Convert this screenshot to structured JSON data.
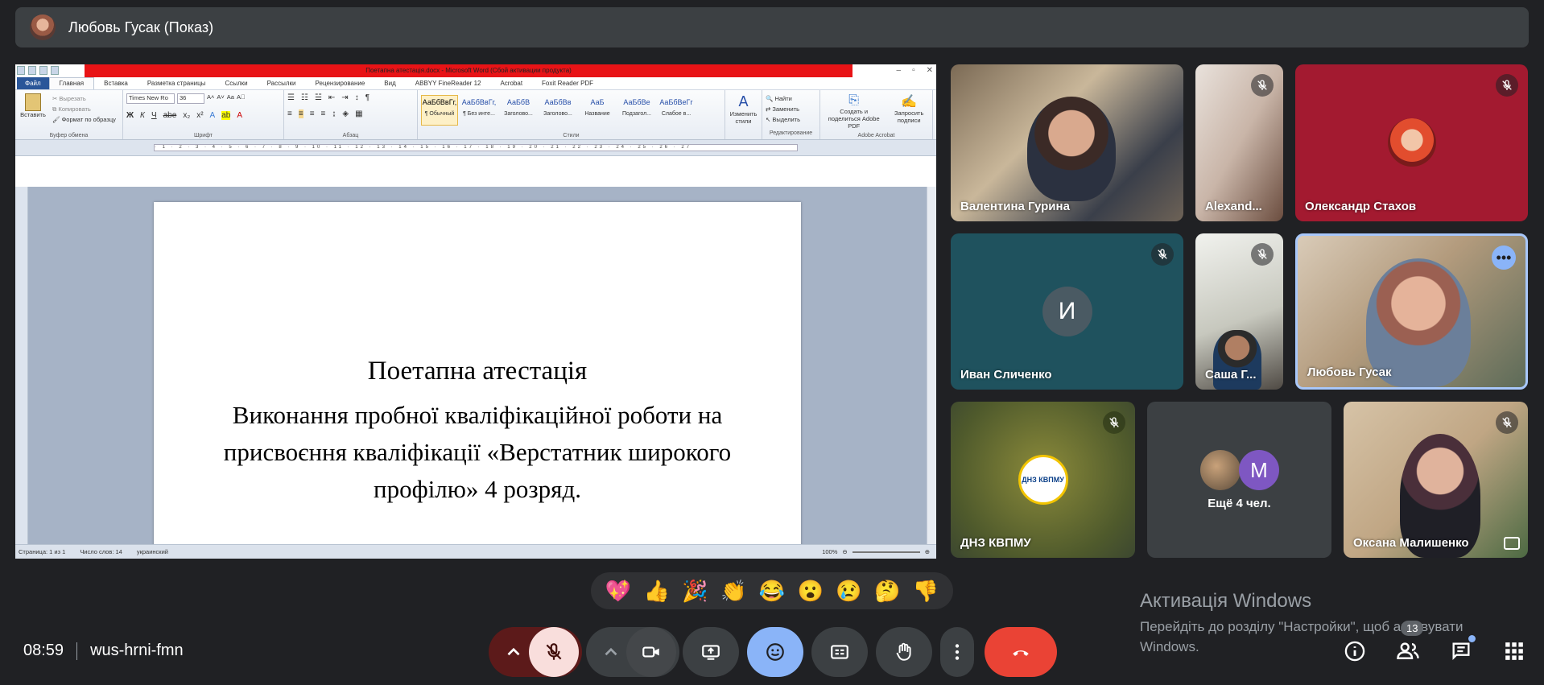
{
  "presenter": {
    "label": "Любовь Гусак (Показ)"
  },
  "word": {
    "title": "Поетапна атестація.docx - Microsoft Word (Сбой активации продукта)",
    "tabs": [
      "Файл",
      "Главная",
      "Вставка",
      "Разметка страницы",
      "Ссылки",
      "Рассылки",
      "Рецензирование",
      "Вид",
      "ABBYY FineReader 12",
      "Acrobat",
      "Foxit Reader PDF"
    ],
    "clipboard": {
      "paste": "Вставить",
      "cut": "Вырезать",
      "copy": "Копировать",
      "format": "Формат по образцу",
      "group": "Буфер обмена"
    },
    "font": {
      "name": "Times New Ro",
      "size": "36",
      "group": "Шрифт"
    },
    "paragraph_group": "Абзац",
    "styles": [
      {
        "sample": "АаБбВвГг,",
        "name": "¶ Обычный"
      },
      {
        "sample": "АаБбВвГг,",
        "name": "¶ Без инте..."
      },
      {
        "sample": "АаБбВ",
        "name": "Заголово..."
      },
      {
        "sample": "АаБбВв",
        "name": "Заголово..."
      },
      {
        "sample": "АаБ",
        "name": "Название"
      },
      {
        "sample": "АаБбВе",
        "name": "Подзагол..."
      },
      {
        "sample": "АаБбВеГг",
        "name": "Слабое в..."
      }
    ],
    "styles_group": "Стили",
    "change_styles": "Изменить стили",
    "editing": {
      "find": "Найти",
      "replace": "Заменить",
      "select": "Выделить",
      "group": "Редактирование"
    },
    "acrobat": {
      "create": "Создать и поделиться Adobe PDF",
      "request": "Запросить подписи",
      "group": "Adobe Acrobat"
    },
    "doc": {
      "heading": "Поетапна атестація",
      "body": "Виконання пробної кваліфікаційної роботи на присвоєння кваліфікації «Верстатник широкого профілю» 4 розряд."
    },
    "status": {
      "page": "Страница: 1 из 1",
      "words": "Число слов: 14",
      "lang": "украинский",
      "zoom": "100%"
    }
  },
  "participants": [
    {
      "name": "Валентина Гурина",
      "muted": false
    },
    {
      "name": "Alexand...",
      "muted": true
    },
    {
      "name": "Олександр Стахов",
      "muted": true
    },
    {
      "name": "Иван Сличенко",
      "muted": true,
      "initial": "И"
    },
    {
      "name": "Саша Г...",
      "muted": true
    },
    {
      "name": "Любовь Гусак",
      "muted": false
    },
    {
      "name": "ДНЗ КВПМУ",
      "muted": true
    },
    {
      "name": "Оксана Малишенко",
      "muted": true
    }
  ],
  "more_people": {
    "label": "Ещё 4 чел.",
    "initial": "M"
  },
  "logo_text": "ДНЗ КВПМУ",
  "reactions": [
    "💖",
    "👍",
    "🎉",
    "👏",
    "😂",
    "😮",
    "😢",
    "🤔",
    "👎"
  ],
  "watermark": {
    "title": "Активація Windows",
    "subtitle": "Перейдіть до розділу \"Настройки\", щоб активувати Windows."
  },
  "meeting": {
    "time": "08:59",
    "code": "wus-hrni-fmn",
    "people_count": "13"
  },
  "colors": {
    "leave": "#ea4335",
    "mic_off": "#f9dedc",
    "emoji_active": "#8ab4f8",
    "bg": "#202124"
  }
}
